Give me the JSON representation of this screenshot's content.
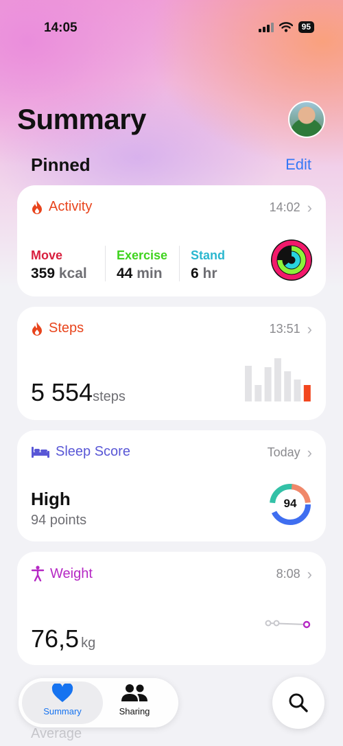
{
  "status_bar": {
    "time": "14:05",
    "battery": "95"
  },
  "header": {
    "title": "Summary",
    "section": "Pinned",
    "edit_label": "Edit"
  },
  "colors": {
    "accent": "#3478f6",
    "activity": "#e8441c",
    "move": "#d81f3e",
    "exercise": "#3fd31e",
    "stand": "#2bb7cf",
    "sleep": "#5957d6",
    "weight": "#b528c4"
  },
  "activity": {
    "title": "Activity",
    "time": "14:02",
    "metrics": [
      {
        "label": "Move",
        "value": "359",
        "unit": "kcal"
      },
      {
        "label": "Exercise",
        "value": "44",
        "unit": "min"
      },
      {
        "label": "Stand",
        "value": "6",
        "unit": "hr"
      }
    ]
  },
  "steps": {
    "title": "Steps",
    "time": "13:51",
    "value": "5 554",
    "unit": "steps",
    "bars": [
      0.79,
      0.36,
      0.75,
      0.95,
      0.66,
      0.49,
      0.36
    ]
  },
  "sleep": {
    "title": "Sleep Score",
    "time": "Today",
    "value": "High",
    "detail": "94 points",
    "score": "94"
  },
  "weight": {
    "title": "Weight",
    "time": "8:08",
    "value": "76,5",
    "unit": "kg"
  },
  "tabs": {
    "summary": "Summary",
    "sharing": "Sharing"
  },
  "below_tabbar": "Average"
}
